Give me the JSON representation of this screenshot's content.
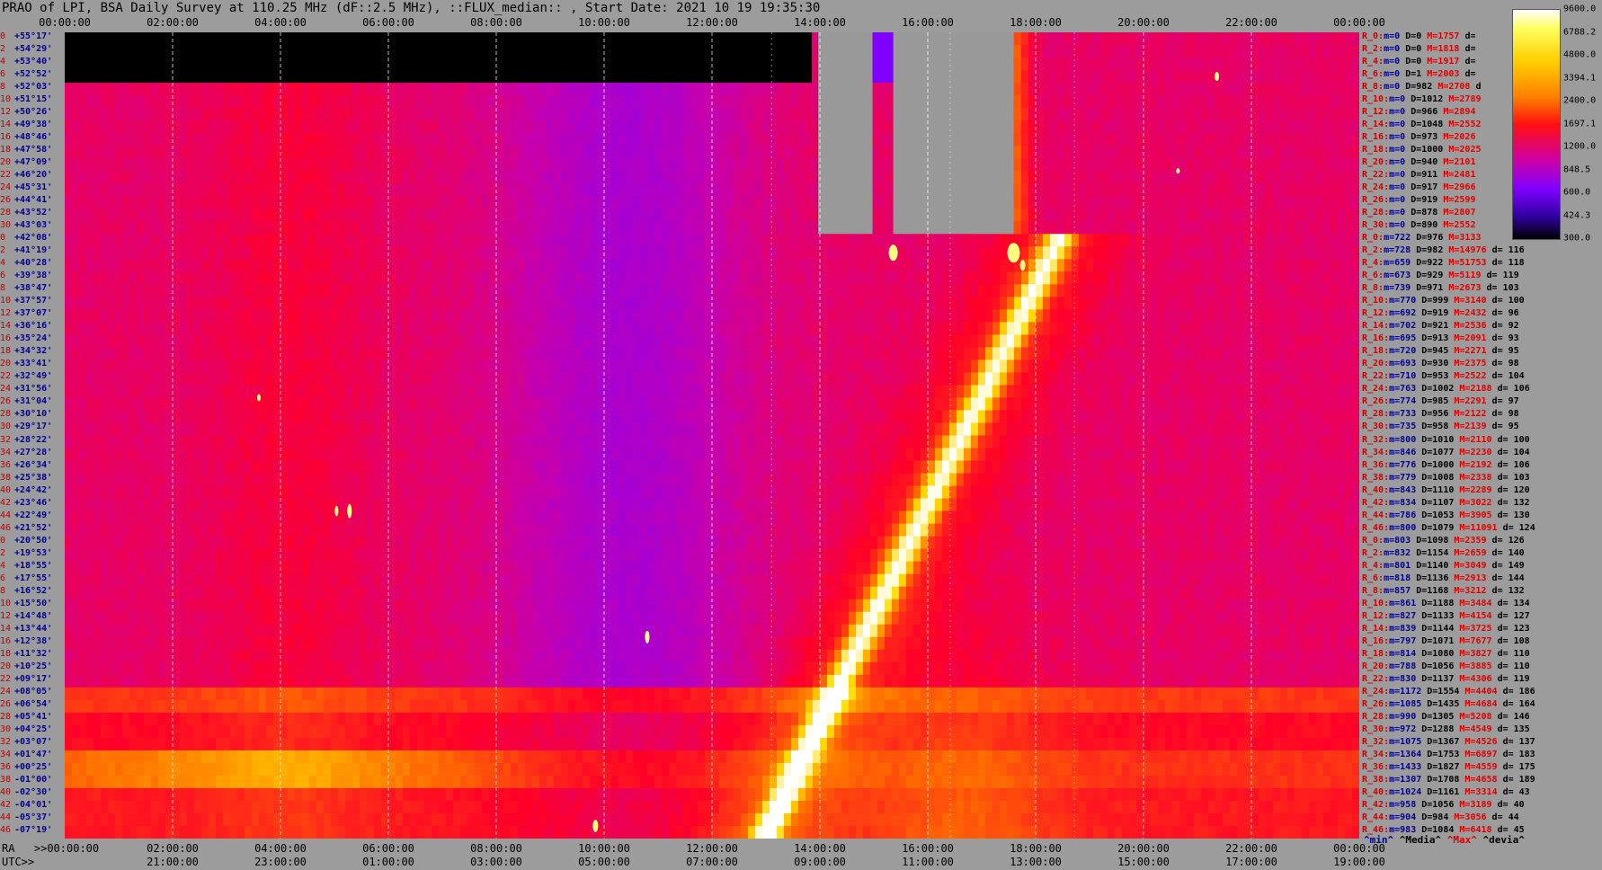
{
  "title": "PRAO of LPI, BSA Daily Survey at 110.25 MHz (dF::2.5 MHz), ::FLUX_median:: , Start Date: 2021 10 19 19:35:30",
  "top_ticks": [
    "00:00:00",
    "02:00:00",
    "04:00:00",
    "06:00:00",
    "08:00:00",
    "10:00:00",
    "12:00:00",
    "14:00:00",
    "16:00:00",
    "18:00:00",
    "20:00:00",
    "22:00:00",
    "00:00:00"
  ],
  "bottom_ra_ticks": [
    ">>00:00:00",
    "02:00:00",
    "04:00:00",
    "06:00:00",
    "08:00:00",
    "10:00:00",
    "12:00:00",
    "14:00:00",
    "16:00:00",
    "18:00:00",
    "20:00:00",
    "22:00:00",
    "00:00:00"
  ],
  "bottom_utc_ticks": [
    "21:00:00",
    "23:00:00",
    "01:00:00",
    "03:00:00",
    "05:00:00",
    "07:00:00",
    "09:00:00",
    "11:00:00",
    "13:00:00",
    "15:00:00",
    "17:00:00",
    "19:00:00"
  ],
  "ra_label": "RA",
  "utc_label": "UTC>>",
  "ylabels": [
    {
      "i": "0",
      "d": "+55°17'"
    },
    {
      "i": "2",
      "d": "+54°29'"
    },
    {
      "i": "4",
      "d": "+53°40'"
    },
    {
      "i": "6",
      "d": "+52°52'"
    },
    {
      "i": "8",
      "d": "+52°03'"
    },
    {
      "i": "10",
      "d": "+51°15'"
    },
    {
      "i": "12",
      "d": "+50°26'"
    },
    {
      "i": "14",
      "d": "+49°38'"
    },
    {
      "i": "16",
      "d": "+48°46'"
    },
    {
      "i": "18",
      "d": "+47°58'"
    },
    {
      "i": "20",
      "d": "+47°09'"
    },
    {
      "i": "22",
      "d": "+46°20'"
    },
    {
      "i": "24",
      "d": "+45°31'"
    },
    {
      "i": "26",
      "d": "+44°41'"
    },
    {
      "i": "28",
      "d": "+43°52'"
    },
    {
      "i": "30",
      "d": "+43°03'"
    },
    {
      "i": "0",
      "d": "+42°08'"
    },
    {
      "i": "2",
      "d": "+41°19'"
    },
    {
      "i": "4",
      "d": "+40°28'"
    },
    {
      "i": "6",
      "d": "+39°38'"
    },
    {
      "i": "8",
      "d": "+38°47'"
    },
    {
      "i": "10",
      "d": "+37°57'"
    },
    {
      "i": "12",
      "d": "+37°07'"
    },
    {
      "i": "14",
      "d": "+36°16'"
    },
    {
      "i": "16",
      "d": "+35°24'"
    },
    {
      "i": "18",
      "d": "+34°32'"
    },
    {
      "i": "20",
      "d": "+33°41'"
    },
    {
      "i": "22",
      "d": "+32°49'"
    },
    {
      "i": "24",
      "d": "+31°56'"
    },
    {
      "i": "26",
      "d": "+31°04'"
    },
    {
      "i": "28",
      "d": "+30°10'"
    },
    {
      "i": "30",
      "d": "+29°17'"
    },
    {
      "i": "32",
      "d": "+28°22'"
    },
    {
      "i": "34",
      "d": "+27°28'"
    },
    {
      "i": "36",
      "d": "+26°34'"
    },
    {
      "i": "38",
      "d": "+25°38'"
    },
    {
      "i": "40",
      "d": "+24°42'"
    },
    {
      "i": "42",
      "d": "+23°46'"
    },
    {
      "i": "44",
      "d": "+22°49'"
    },
    {
      "i": "46",
      "d": "+21°52'"
    },
    {
      "i": "0",
      "d": "+20°50'"
    },
    {
      "i": "2",
      "d": "+19°53'"
    },
    {
      "i": "4",
      "d": "+18°55'"
    },
    {
      "i": "6",
      "d": "+17°55'"
    },
    {
      "i": "8",
      "d": "+16°52'"
    },
    {
      "i": "10",
      "d": "+15°50'"
    },
    {
      "i": "12",
      "d": "+14°48'"
    },
    {
      "i": "14",
      "d": "+13°44'"
    },
    {
      "i": "16",
      "d": "+12°38'"
    },
    {
      "i": "18",
      "d": "+11°32'"
    },
    {
      "i": "20",
      "d": "+10°25'"
    },
    {
      "i": "22",
      "d": "+09°17'"
    },
    {
      "i": "24",
      "d": "+08°05'"
    },
    {
      "i": "26",
      "d": "+06°54'"
    },
    {
      "i": "28",
      "d": "+05°41'"
    },
    {
      "i": "30",
      "d": "+04°25'"
    },
    {
      "i": "32",
      "d": "+03°07'"
    },
    {
      "i": "34",
      "d": "+01°47'"
    },
    {
      "i": "36",
      "d": "+00°25'"
    },
    {
      "i": "38",
      "d": "-01°00'"
    },
    {
      "i": "40",
      "d": "-02°30'"
    },
    {
      "i": "42",
      "d": "-04°01'"
    },
    {
      "i": "44",
      "d": "-05°37'"
    },
    {
      "i": "46",
      "d": "-07°19'"
    }
  ],
  "right_stats": [
    {
      "r": "R_0:",
      "m": "m=0",
      "D": "D=0",
      "M": "M=1757",
      "d": "d="
    },
    {
      "r": "R_2:",
      "m": "m=0",
      "D": "D=0",
      "M": "M=1818",
      "d": "d="
    },
    {
      "r": "R_4:",
      "m": "m=0",
      "D": "D=0",
      "M": "M=1917",
      "d": "d="
    },
    {
      "r": "R_6:",
      "m": "m=0",
      "D": "D=1",
      "M": "M=2003",
      "d": "d="
    },
    {
      "r": "R_8:",
      "m": "m=0",
      "D": "D=982",
      "M": "M=2708",
      "d": "d"
    },
    {
      "r": "R_10:",
      "m": "m=0",
      "D": "D=1012",
      "M": "M=2789",
      "d": ""
    },
    {
      "r": "R_12:",
      "m": "m=0",
      "D": "D=966",
      "M": "M=2894",
      "d": ""
    },
    {
      "r": "R_14:",
      "m": "m=0",
      "D": "D=1048",
      "M": "M=2552",
      "d": ""
    },
    {
      "r": "R_16:",
      "m": "m=0",
      "D": "D=973",
      "M": "M=2026",
      "d": ""
    },
    {
      "r": "R_18:",
      "m": "m=0",
      "D": "D=1000",
      "M": "M=2025",
      "d": ""
    },
    {
      "r": "R_20:",
      "m": "m=0",
      "D": "D=940",
      "M": "M=2101",
      "d": ""
    },
    {
      "r": "R_22:",
      "m": "m=0",
      "D": "D=911",
      "M": "M=2481",
      "d": ""
    },
    {
      "r": "R_24:",
      "m": "m=0",
      "D": "D=917",
      "M": "M=2966",
      "d": ""
    },
    {
      "r": "R_26:",
      "m": "m=0",
      "D": "D=919",
      "M": "M=2599",
      "d": ""
    },
    {
      "r": "R_28:",
      "m": "m=0",
      "D": "D=878",
      "M": "M=2807",
      "d": ""
    },
    {
      "r": "R_30:",
      "m": "m=0",
      "D": "D=890",
      "M": "M=2552",
      "d": ""
    },
    {
      "r": "R_0:",
      "m": "m=722",
      "D": "D=976",
      "M": "M=3133",
      "d": ""
    },
    {
      "r": "R_2:",
      "m": "m=728",
      "D": "D=982",
      "M": "M=14976",
      "d": "d= 116"
    },
    {
      "r": "R_4:",
      "m": "m=659",
      "D": "D=922",
      "M": "M=51753",
      "d": "d= 118"
    },
    {
      "r": "R_6:",
      "m": "m=673",
      "D": "D=929",
      "M": "M=5119",
      "d": "d= 119"
    },
    {
      "r": "R_8:",
      "m": "m=739",
      "D": "D=971",
      "M": "M=2673",
      "d": "d= 103"
    },
    {
      "r": "R_10:",
      "m": "m=770",
      "D": "D=999",
      "M": "M=3140",
      "d": "d= 100"
    },
    {
      "r": "R_12:",
      "m": "m=692",
      "D": "D=919",
      "M": "M=2432",
      "d": "d= 96"
    },
    {
      "r": "R_14:",
      "m": "m=702",
      "D": "D=921",
      "M": "M=2536",
      "d": "d= 92"
    },
    {
      "r": "R_16:",
      "m": "m=695",
      "D": "D=913",
      "M": "M=2091",
      "d": "d= 93"
    },
    {
      "r": "R_18:",
      "m": "m=720",
      "D": "D=945",
      "M": "M=2271",
      "d": "d= 95"
    },
    {
      "r": "R_20:",
      "m": "m=693",
      "D": "D=930",
      "M": "M=2375",
      "d": "d= 98"
    },
    {
      "r": "R_22:",
      "m": "m=710",
      "D": "D=953",
      "M": "M=2522",
      "d": "d= 104"
    },
    {
      "r": "R_24:",
      "m": "m=763",
      "D": "D=1002",
      "M": "M=2188",
      "d": "d= 106"
    },
    {
      "r": "R_26:",
      "m": "m=774",
      "D": "D=985",
      "M": "M=2291",
      "d": "d= 97"
    },
    {
      "r": "R_28:",
      "m": "m=733",
      "D": "D=956",
      "M": "M=2122",
      "d": "d= 98"
    },
    {
      "r": "R_30:",
      "m": "m=735",
      "D": "D=958",
      "M": "M=2139",
      "d": "d= 95"
    },
    {
      "r": "R_32:",
      "m": "m=800",
      "D": "D=1010",
      "M": "M=2110",
      "d": "d= 100"
    },
    {
      "r": "R_34:",
      "m": "m=846",
      "D": "D=1077",
      "M": "M=2230",
      "d": "d= 104"
    },
    {
      "r": "R_36:",
      "m": "m=776",
      "D": "D=1000",
      "M": "M=2192",
      "d": "d= 106"
    },
    {
      "r": "R_38:",
      "m": "m=779",
      "D": "D=1008",
      "M": "M=2338",
      "d": "d= 103"
    },
    {
      "r": "R_40:",
      "m": "m=843",
      "D": "D=1110",
      "M": "M=2289",
      "d": "d= 120"
    },
    {
      "r": "R_42:",
      "m": "m=834",
      "D": "D=1107",
      "M": "M=3022",
      "d": "d= 132"
    },
    {
      "r": "R_44:",
      "m": "m=786",
      "D": "D=1053",
      "M": "M=3905",
      "d": "d= 130"
    },
    {
      "r": "R_46:",
      "m": "m=800",
      "D": "D=1079",
      "M": "M=11091",
      "d": "d= 124"
    },
    {
      "r": "R_0:",
      "m": "m=803",
      "D": "D=1098",
      "M": "M=2359",
      "d": "d= 126"
    },
    {
      "r": "R_2:",
      "m": "m=832",
      "D": "D=1154",
      "M": "M=2659",
      "d": "d= 140"
    },
    {
      "r": "R_4:",
      "m": "m=801",
      "D": "D=1140",
      "M": "M=3049",
      "d": "d= 149"
    },
    {
      "r": "R_6:",
      "m": "m=818",
      "D": "D=1136",
      "M": "M=2913",
      "d": "d= 144"
    },
    {
      "r": "R_8:",
      "m": "m=857",
      "D": "D=1168",
      "M": "M=3212",
      "d": "d= 132"
    },
    {
      "r": "R_10:",
      "m": "m=861",
      "D": "D=1188",
      "M": "M=3484",
      "d": "d= 134"
    },
    {
      "r": "R_12:",
      "m": "m=827",
      "D": "D=1133",
      "M": "M=4154",
      "d": "d= 127"
    },
    {
      "r": "R_14:",
      "m": "m=839",
      "D": "D=1144",
      "M": "M=3725",
      "d": "d= 123"
    },
    {
      "r": "R_16:",
      "m": "m=797",
      "D": "D=1071",
      "M": "M=7677",
      "d": "d= 108"
    },
    {
      "r": "R_18:",
      "m": "m=814",
      "D": "D=1080",
      "M": "M=3827",
      "d": "d= 110"
    },
    {
      "r": "R_20:",
      "m": "m=788",
      "D": "D=1056",
      "M": "M=3885",
      "d": "d= 110"
    },
    {
      "r": "R_22:",
      "m": "m=830",
      "D": "D=1137",
      "M": "M=4306",
      "d": "d= 119"
    },
    {
      "r": "R_24:",
      "m": "m=1172",
      "D": "D=1554",
      "M": "M=4404",
      "d": "d= 186"
    },
    {
      "r": "R_26:",
      "m": "m=1085",
      "D": "D=1435",
      "M": "M=4684",
      "d": "d= 164"
    },
    {
      "r": "R_28:",
      "m": "m=990",
      "D": "D=1305",
      "M": "M=5208",
      "d": "d= 146"
    },
    {
      "r": "R_30:",
      "m": "m=972",
      "D": "D=1288",
      "M": "M=4549",
      "d": "d= 135"
    },
    {
      "r": "R_32:",
      "m": "m=1075",
      "D": "D=1367",
      "M": "M=4526",
      "d": "d= 137"
    },
    {
      "r": "R_34:",
      "m": "m=1364",
      "D": "D=1753",
      "M": "M=6897",
      "d": "d= 183"
    },
    {
      "r": "R_36:",
      "m": "m=1433",
      "D": "D=1827",
      "M": "M=4559",
      "d": "d= 175"
    },
    {
      "r": "R_38:",
      "m": "m=1307",
      "D": "D=1708",
      "M": "M=4658",
      "d": "d= 189"
    },
    {
      "r": "R_40:",
      "m": "m=1024",
      "D": "D=1161",
      "M": "M=3314",
      "d": "d= 43"
    },
    {
      "r": "R_42:",
      "m": "m=958",
      "D": "D=1056",
      "M": "M=3189",
      "d": "d= 40"
    },
    {
      "r": "R_44:",
      "m": "m=904",
      "D": "D=984",
      "M": "M=3056",
      "d": "d= 44"
    },
    {
      "r": "R_46:",
      "m": "m=983",
      "D": "D=1084",
      "M": "M=6418",
      "d": "d= 45"
    }
  ],
  "footer_stats": {
    "min": "^min^",
    "median": "^Media^",
    "max": "^Max^",
    "devia": "^devia^"
  },
  "colorbar_labels": [
    "9600.0",
    "6788.2",
    "4800.0",
    "3394.1",
    "2400.0",
    "1697.1",
    "1200.0",
    "848.5",
    "600.0",
    "424.3",
    "300.0"
  ],
  "chart_data": {
    "type": "heatmap",
    "title": "PRAO of LPI, BSA Daily Survey at 110.25 MHz (dF::2.5 MHz), ::FLUX_median:: , Start Date: 2021 10 19 19:35:30",
    "xlabel": "RA",
    "x_ticks_ra": [
      "00:00:00",
      "02:00:00",
      "04:00:00",
      "06:00:00",
      "08:00:00",
      "10:00:00",
      "12:00:00",
      "14:00:00",
      "16:00:00",
      "18:00:00",
      "20:00:00",
      "22:00:00",
      "00:00:00"
    ],
    "x_ticks_utc": [
      "21:00:00",
      "23:00:00",
      "01:00:00",
      "03:00:00",
      "05:00:00",
      "07:00:00",
      "09:00:00",
      "11:00:00",
      "13:00:00",
      "15:00:00",
      "17:00:00",
      "19:00:00"
    ],
    "rows": 64,
    "color_scale": {
      "min": 300.0,
      "max": 9600.0,
      "log": true
    },
    "grid": true,
    "colors": {
      "low": "#000000",
      "mid_low": "#7a00ff",
      "mid": "#ff0000",
      "high": "#ffff00",
      "top": "#ffffff",
      "gap": "#999999",
      "missing": "#000000"
    }
  }
}
